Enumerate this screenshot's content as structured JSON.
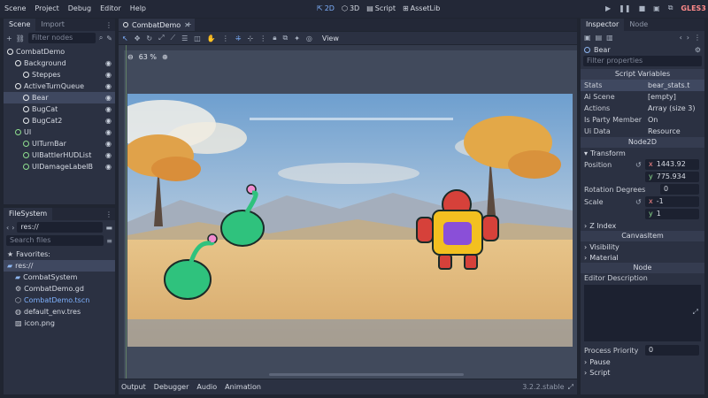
{
  "menu": [
    "Scene",
    "Project",
    "Debug",
    "Editor",
    "Help"
  ],
  "workspaces": [
    {
      "label": "2D",
      "icon": "2d-icon",
      "active": true
    },
    {
      "label": "3D",
      "icon": "3d-icon",
      "active": false
    },
    {
      "label": "Script",
      "icon": "script-icon",
      "active": false
    },
    {
      "label": "AssetLib",
      "icon": "assetlib-icon",
      "active": false
    }
  ],
  "renderer": "GLES3",
  "scene_dock": {
    "tabs": [
      "Scene",
      "Import"
    ],
    "filter_placeholder": "Filter nodes",
    "tree": [
      {
        "label": "CombatDemo",
        "depth": 0,
        "icon": "node2d-icon"
      },
      {
        "label": "Background",
        "depth": 1,
        "icon": "node2d-icon"
      },
      {
        "label": "Steppes",
        "depth": 2,
        "icon": "sprite-icon"
      },
      {
        "label": "ActiveTurnQueue",
        "depth": 1,
        "icon": "node2d-icon"
      },
      {
        "label": "Bear",
        "depth": 2,
        "icon": "node2d-icon",
        "selected": true
      },
      {
        "label": "BugCat",
        "depth": 2,
        "icon": "node2d-icon"
      },
      {
        "label": "BugCat2",
        "depth": 2,
        "icon": "node2d-icon"
      },
      {
        "label": "UI",
        "depth": 1,
        "icon": "control-icon"
      },
      {
        "label": "UITurnBar",
        "depth": 2,
        "icon": "control-icon"
      },
      {
        "label": "UIBattlerHUDList",
        "depth": 2,
        "icon": "control-icon"
      },
      {
        "label": "UIDamageLabelB",
        "depth": 2,
        "icon": "control-icon"
      }
    ]
  },
  "filesystem": {
    "tab": "FileSystem",
    "path": "res://",
    "search_placeholder": "Search files",
    "items": [
      {
        "label": "Favorites:",
        "depth": 0,
        "icon": "star-icon"
      },
      {
        "label": "res://",
        "depth": 0,
        "icon": "folder-icon",
        "selected": true
      },
      {
        "label": "CombatSystem",
        "depth": 1,
        "icon": "folder-icon"
      },
      {
        "label": "CombatDemo.gd",
        "depth": 1,
        "icon": "gear-icon"
      },
      {
        "label": "CombatDemo.tscn",
        "depth": 1,
        "icon": "scene-icon",
        "highlight": true
      },
      {
        "label": "default_env.tres",
        "depth": 1,
        "icon": "globe-icon"
      },
      {
        "label": "icon.png",
        "depth": 1,
        "icon": "image-icon"
      }
    ]
  },
  "editor": {
    "tab": "CombatDemo",
    "view_label": "View",
    "zoom": "63 %"
  },
  "bottom_panel": {
    "tabs": [
      "Output",
      "Debugger",
      "Audio",
      "Animation"
    ],
    "version": "3.2.2.stable"
  },
  "inspector": {
    "tabs": [
      "Inspector",
      "Node"
    ],
    "node_name": "Bear",
    "filter_placeholder": "Filter properties",
    "script_section": "Script Variables",
    "props": [
      {
        "key": "Stats",
        "value": "bear_stats.t"
      },
      {
        "key": "Ai Scene",
        "value": "[empty]"
      },
      {
        "key": "Actions",
        "value": "Array (size 3)"
      },
      {
        "key": "Is Party Member",
        "value": "On"
      },
      {
        "key": "Ui Data",
        "value": "Resource"
      }
    ],
    "node2d": "Node2D",
    "transform": "Transform",
    "position_key": "Position",
    "pos_x": "1443.92",
    "pos_y": "775.934",
    "rotation_key": "Rotation Degrees",
    "rotation": "0",
    "scale_key": "Scale",
    "scale_x": "-1",
    "scale_y": "1",
    "z_index": "Z Index",
    "canvas_item": "CanvasItem",
    "visibility": "Visibility",
    "material": "Material",
    "node_section": "Node",
    "editor_description": "Editor Description",
    "process_priority_key": "Process Priority",
    "process_priority": "0",
    "pause": "Pause",
    "script": "Script"
  },
  "colors": {
    "accent": "#7fb2ff",
    "renderer": "#ff8a8a",
    "panel": "#2b3142",
    "background": "#202531"
  }
}
